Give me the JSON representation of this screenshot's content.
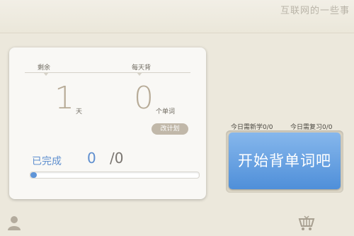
{
  "watermark": "互联网的一些事",
  "card": {
    "remaining_label": "剩余",
    "daily_label": "每天背",
    "remaining_value": "1",
    "remaining_unit": "天",
    "daily_value": "0",
    "daily_unit": "个单词",
    "plan_button": "改计划",
    "completed_label": "已完成",
    "completed_count": "0",
    "completed_total": "/0",
    "progress_fraction": 0
  },
  "stats": {
    "new_label": "今日需新学0/0",
    "review_label": "今日需复习0/0"
  },
  "start_button": "开始背单词吧",
  "icons": {
    "profile": "user-icon",
    "store": "cart-icon"
  },
  "colors": {
    "accent": "#5f95d8",
    "background": "#ece8dc",
    "number": "#b7ab97"
  }
}
